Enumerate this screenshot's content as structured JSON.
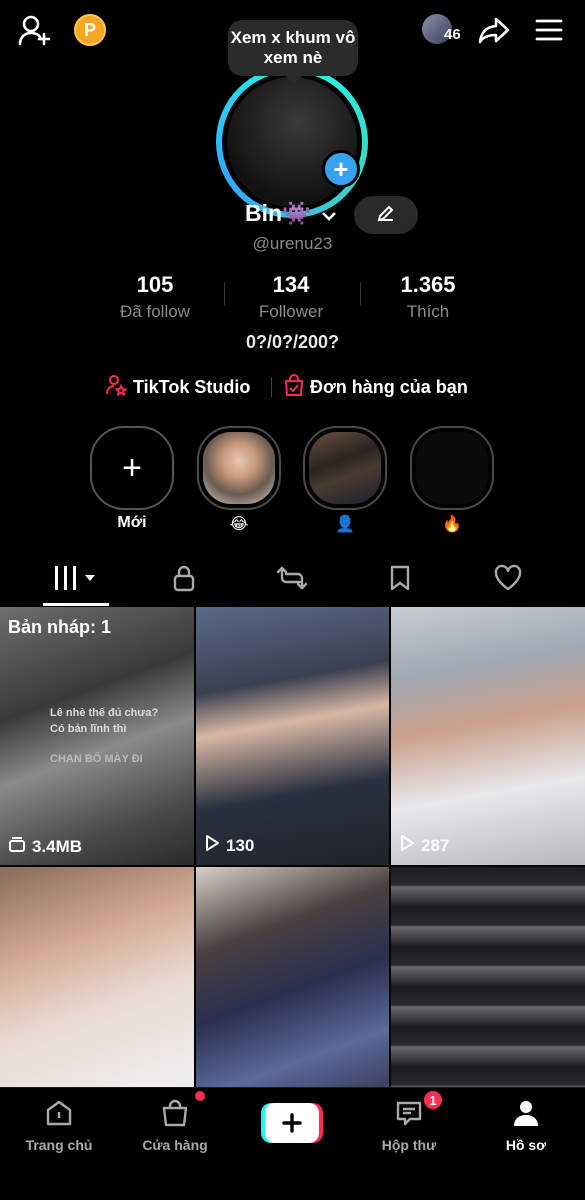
{
  "topbar": {
    "add_friend_icon": "person-plus-icon",
    "coin_icon": "p-coin-icon",
    "coin_letter": "P",
    "friends_count": "46",
    "share_icon": "share-arrow-icon",
    "menu_icon": "hamburger-menu-icon"
  },
  "profile": {
    "note": "Xem x khum vô xem nè",
    "display_name": "Bin👾",
    "handle": "@urenu23",
    "bio": "0?/0?/200?",
    "stats": [
      {
        "value": "105",
        "label": "Đã follow"
      },
      {
        "value": "134",
        "label": "Follower"
      },
      {
        "value": "1.365",
        "label": "Thích"
      }
    ],
    "links": [
      {
        "label": "TikTok Studio",
        "icon": "studio-person-star-icon"
      },
      {
        "label": "Đơn hàng của bạn",
        "icon": "shopping-bag-check-icon"
      }
    ]
  },
  "highlights": [
    {
      "label": "Mới",
      "type": "new"
    },
    {
      "label": "😂",
      "type": "story"
    },
    {
      "label": "👤",
      "type": "story"
    },
    {
      "label": "🔥",
      "type": "story"
    }
  ],
  "tabs": [
    {
      "name": "videos",
      "icon": "grid-columns-icon",
      "active": true
    },
    {
      "name": "private",
      "icon": "lock-icon",
      "active": false
    },
    {
      "name": "reposts",
      "icon": "repost-icon",
      "active": false
    },
    {
      "name": "favorites",
      "icon": "bookmark-icon",
      "active": false
    },
    {
      "name": "liked",
      "icon": "heart-icon",
      "active": false
    }
  ],
  "grid": {
    "draft_label": "Bản nháp: 1",
    "draft_size": "3.4MB",
    "draft_overlay_line1": "Lê nhè thế đủ chưa?",
    "draft_overlay_line2": "Có bản lĩnh thì",
    "draft_overlay_line3": "CHAN BỐ MÀY ĐI",
    "views": [
      "130",
      "287"
    ]
  },
  "bottom_nav": [
    {
      "label": "Trang chủ",
      "icon": "home-icon"
    },
    {
      "label": "Cửa hàng",
      "icon": "shopping-bag-icon"
    },
    {
      "label": "",
      "icon": "create-plus-icon"
    },
    {
      "label": "Hộp thư",
      "icon": "inbox-message-icon",
      "badge": "1"
    },
    {
      "label": "Hồ sơ",
      "icon": "profile-person-icon",
      "active": true
    }
  ],
  "colors": {
    "background": "#000000",
    "accent_red": "#fe2c55",
    "accent_cyan": "#25f4ee",
    "muted_text": "#8a8a8a",
    "coin": "#f5a623"
  }
}
